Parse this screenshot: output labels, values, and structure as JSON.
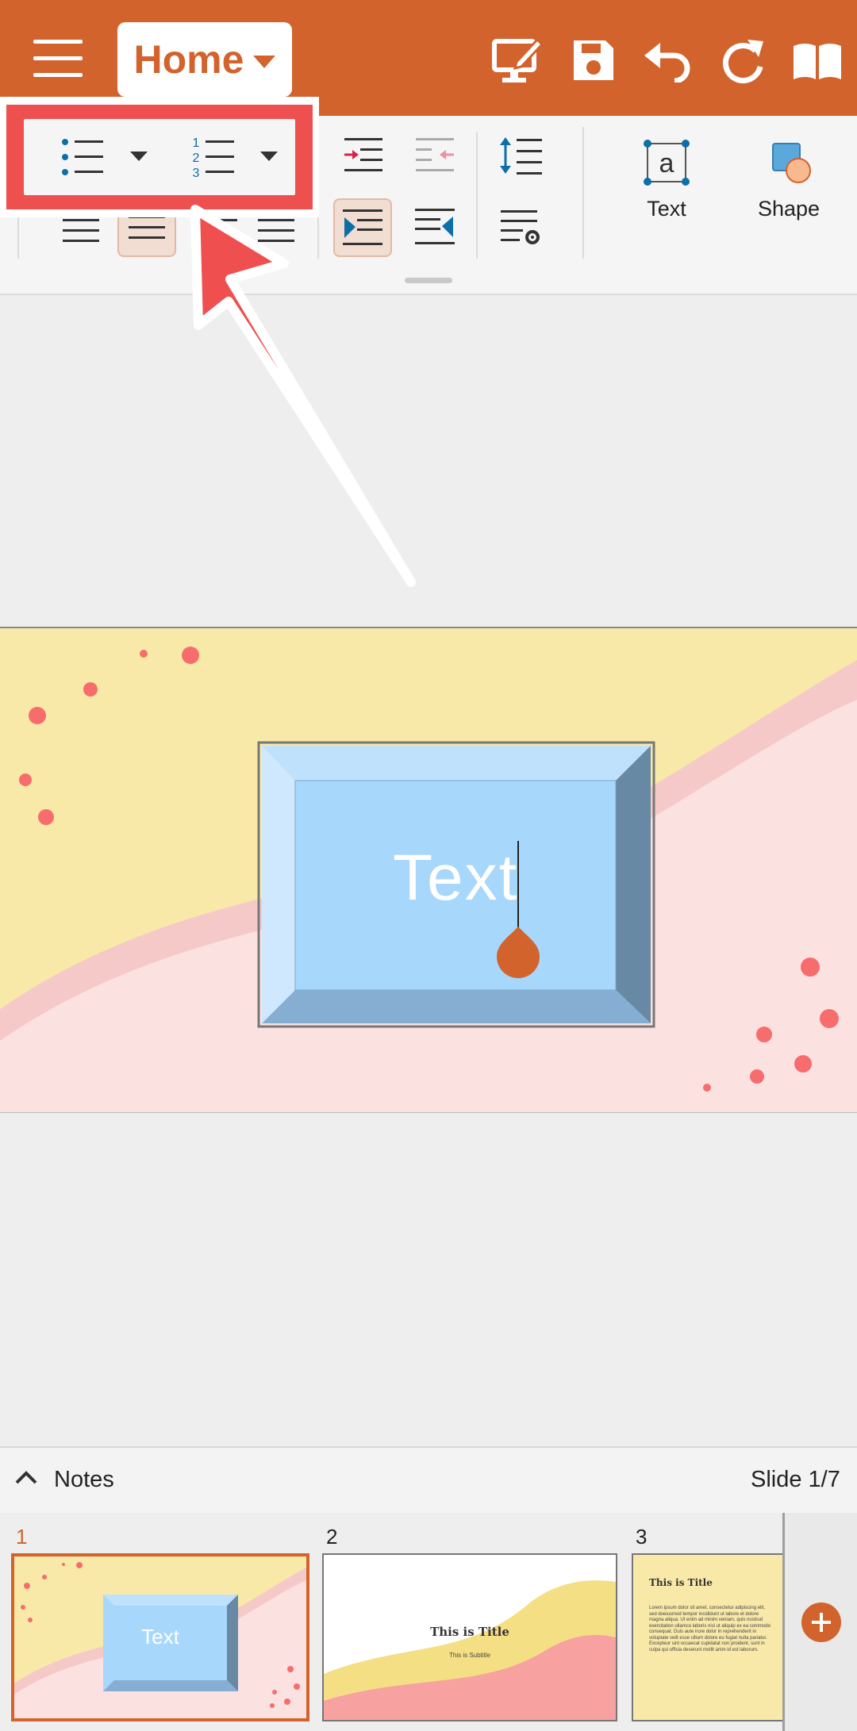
{
  "app": {
    "accent": "#d2632d",
    "tab_label": "Home",
    "top_icons": [
      "menu-icon",
      "presenter-icon",
      "save-icon",
      "undo-icon",
      "redo-icon",
      "read-mode-icon"
    ]
  },
  "toolbar": {
    "text_label": "Text",
    "shape_label": "Shape",
    "icons": [
      "bulleted-list-icon",
      "numbered-list-icon",
      "increase-indent-icon",
      "decrease-indent-icon",
      "line-spacing-icon",
      "align-left-icon",
      "align-center-icon",
      "align-right-icon",
      "justify-icon",
      "ltr-paragraph-icon",
      "rtl-paragraph-icon",
      "paragraph-settings-icon"
    ]
  },
  "slide": {
    "textbox_text": "Text"
  },
  "notes": {
    "label": "Notes",
    "slide_indicator": "Slide 1/7"
  },
  "thumbnails": [
    {
      "number": "1",
      "text": "Text"
    },
    {
      "number": "2",
      "title": "This is Title",
      "subtitle": "This is Subtitle"
    },
    {
      "number": "3",
      "title": "This is Title",
      "body": "Lorem ipsum dolor sit amet, consectetur adipiscing elit, sed doeiusmod tempor incididunt ut labore et dolore magna aliqua. Ut enim ad minim veniam, quis nostrud exercitation ullamco laboris nisi ut aliquip ex ea commodo consequat. Duis aute irure dolor in reprehenderit in voluptate velit esse cillum dolore eu fugiat nulla pariatur. Excepteur sint occaecat cupidatat non proident, sunt in culpa qui officia deserunt mollit anim id est laborum."
    }
  ]
}
